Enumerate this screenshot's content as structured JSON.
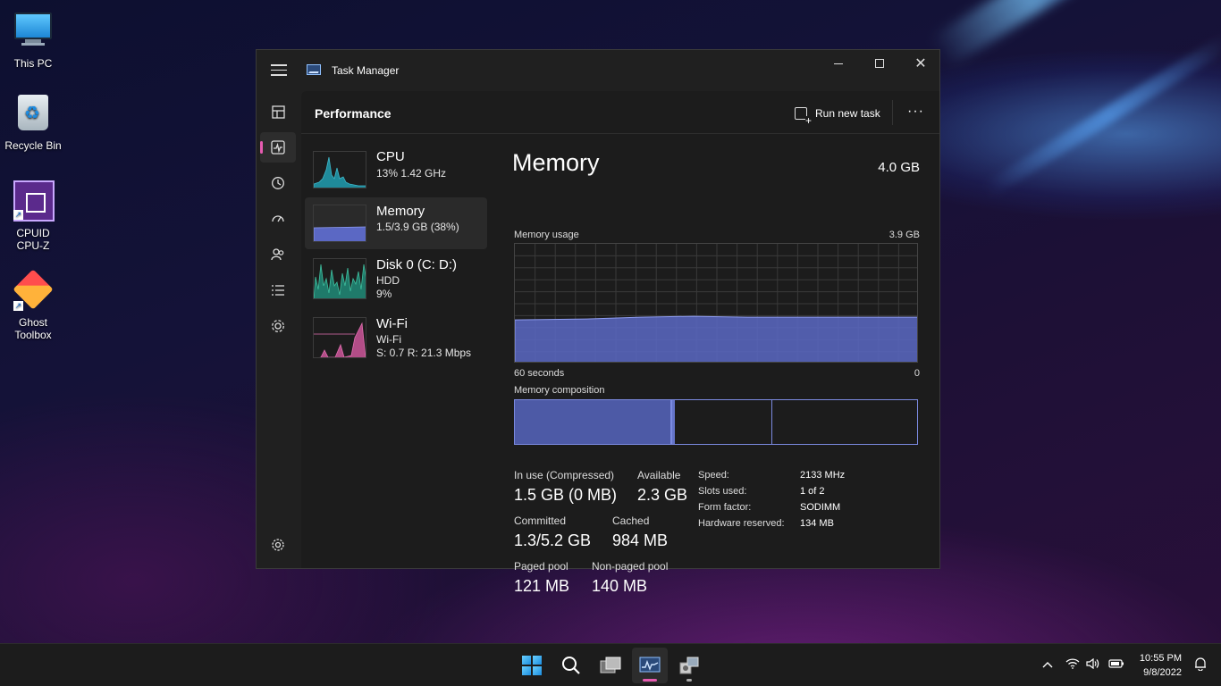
{
  "desktop": {
    "icons": [
      {
        "label": "This PC"
      },
      {
        "label": "Recycle Bin"
      },
      {
        "label": "CPUID\nCPU-Z"
      },
      {
        "label": "Ghost\nToolbox"
      }
    ]
  },
  "window": {
    "title": "Task Manager",
    "page_title": "Performance",
    "run_new_task": "Run new task",
    "more": "···"
  },
  "nav_icons": [
    "hamburger-icon",
    "processes-icon",
    "performance-icon",
    "app-history-icon",
    "startup-icon",
    "users-icon",
    "details-icon",
    "services-icon",
    "settings-icon"
  ],
  "resources": [
    {
      "name": "CPU",
      "line1": "13%  1.42 GHz",
      "line2": ""
    },
    {
      "name": "Memory",
      "line1": "1.5/3.9 GB (38%)",
      "line2": ""
    },
    {
      "name": "Disk 0 (C: D:)",
      "line1": "HDD",
      "line2": "9%"
    },
    {
      "name": "Wi-Fi",
      "line1": "Wi-Fi",
      "line2": "S: 0.7  R: 21.3 Mbps"
    }
  ],
  "memory": {
    "title": "Memory",
    "total": "4.0 GB",
    "usage_label": "Memory usage",
    "usage_max": "3.9 GB",
    "axis_left": "60 seconds",
    "axis_right": "0",
    "composition_label": "Memory composition",
    "usage_fraction": 0.38,
    "stats": {
      "in_use_label": "In use (Compressed)",
      "in_use_value": "1.5 GB (0 MB)",
      "available_label": "Available",
      "available_value": "2.3 GB",
      "committed_label": "Committed",
      "committed_value": "1.3/5.2 GB",
      "cached_label": "Cached",
      "cached_value": "984 MB",
      "paged_label": "Paged pool",
      "paged_value": "121 MB",
      "nonpaged_label": "Non-paged pool",
      "nonpaged_value": "140 MB"
    },
    "specs": {
      "speed_label": "Speed:",
      "speed_value": "2133 MHz",
      "slots_label": "Slots used:",
      "slots_value": "1 of 2",
      "form_label": "Form factor:",
      "form_value": "SODIMM",
      "hw_label": "Hardware reserved:",
      "hw_value": "134 MB"
    }
  },
  "taskbar": {
    "time": "10:55 PM",
    "date": "9/8/2022"
  },
  "colors": {
    "accent": "#e65bb0",
    "memory_fill": "#5b68c4",
    "memory_line": "#8e9cf0",
    "cpu_fill": "#1f8a9a",
    "wifi_line": "#e26fb1"
  }
}
